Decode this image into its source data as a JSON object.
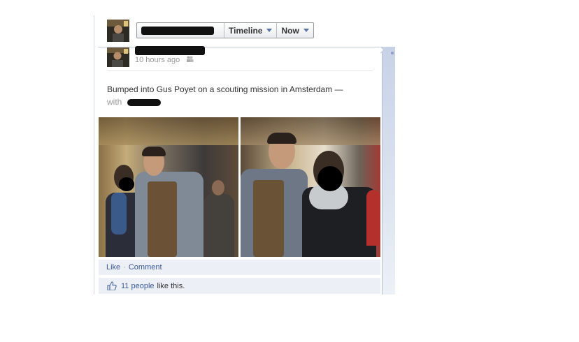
{
  "header": {
    "timeline_label": "Timeline",
    "now_label": "Now"
  },
  "post": {
    "timestamp": "10 hours ago",
    "status_text": "Bumped into Gus Poyet on a scouting mission in Amsterdam —",
    "with_label": "with"
  },
  "actions": {
    "like_label": "Like",
    "separator": "·",
    "comment_label": "Comment"
  },
  "likes": {
    "count_label": "11 people",
    "suffix": "like this."
  },
  "colors": {
    "link": "#3b5998",
    "action_bg": "#eceff5",
    "rail": "#c7d2e6"
  }
}
